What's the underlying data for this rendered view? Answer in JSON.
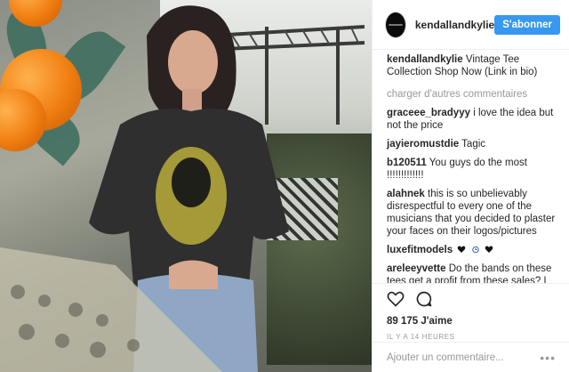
{
  "post": {
    "image_alt": "Photo of a woman wearing a black vintage band tee in a garden",
    "colors": {
      "accent": "#3897f0",
      "text": "#262626",
      "muted": "#999999",
      "border": "#efefef",
      "orange": "#f07d10"
    }
  },
  "header": {
    "username": "kendallandkylie",
    "follow_label": "S'abonner"
  },
  "caption": {
    "username": "kendallandkylie",
    "text": "Vintage Tee Collection Shop Now (Link in bio)"
  },
  "load_more_label": "charger d'autres commentaires",
  "comments": [
    {
      "username": "graceee_bradyyy",
      "text": "i love the idea but not the price"
    },
    {
      "username": "jayieromustdie",
      "text": "Tagic"
    },
    {
      "username": "b120511",
      "text": "You guys do the most !!!!!!!!!!!!!"
    },
    {
      "username": "alahnek",
      "text": "this is so unbelievably disrespectful to every one of the musicians that you decided to plaster your faces on their logos/pictures"
    },
    {
      "username": "luxefitmodels",
      "text": ""
    },
    {
      "username": "areleeyvette",
      "text": "Do the bands on these tees get a profit from these sales? I mean...c'mon with all the money these girls make you'd think they'd hire people with original ideas, and plastering your faces on"
    }
  ],
  "actions": {
    "like_icon": "heart-icon",
    "comment_icon": "comment-icon",
    "likes_text": "89 175 J'aime",
    "timestamp": "Il y a 14 heures"
  },
  "add_comment": {
    "placeholder": "Ajouter un commentaire...",
    "more_icon": "more-dots-icon"
  }
}
